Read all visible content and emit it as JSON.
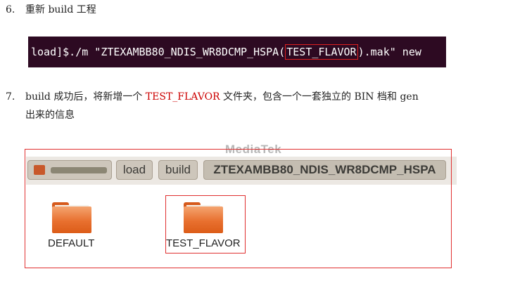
{
  "step6": {
    "number": "6.",
    "text": "重新 build 工程"
  },
  "terminal": {
    "prefix": "load]$./m \"ZTEXAMBB80_NDIS_WR8DCMP_HSPA(",
    "highlight": "TEST_FLAVOR",
    "suffix": ").mak\" new",
    "background": "#2d0a22"
  },
  "step7": {
    "number": "7.",
    "text_a": "build 成功后，将新增一个 ",
    "highlight": "TEST_FLAVOR",
    "text_b": " 文件夹，包含一个一套独立的 BIN 档和 gen",
    "line2": "出来的信息",
    "highlight_color": "#cc0000"
  },
  "watermark": "MediaTek",
  "pathbar": {
    "crumbs": [
      "load",
      "build",
      "ZTEXAMBB80_NDIS_WR8DCMP_HSPA"
    ]
  },
  "folders": [
    {
      "label": "DEFAULT",
      "icon": "folder-icon"
    },
    {
      "label": "TEST_FLAVOR",
      "icon": "folder-icon"
    }
  ]
}
